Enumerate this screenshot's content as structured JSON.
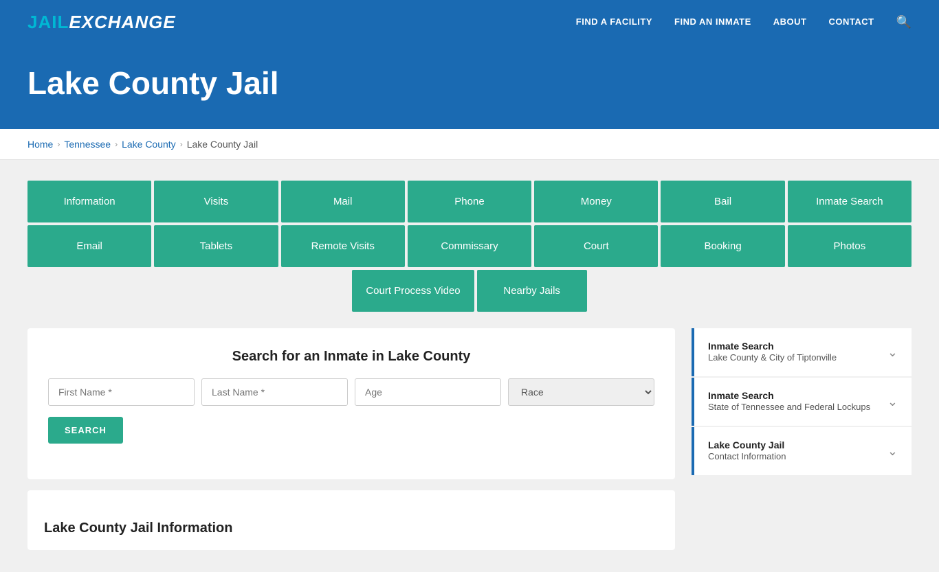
{
  "nav": {
    "logo_jail": "JAIL",
    "logo_exchange": "EXCHANGE",
    "links": [
      {
        "label": "FIND A FACILITY",
        "href": "#"
      },
      {
        "label": "FIND AN INMATE",
        "href": "#"
      },
      {
        "label": "ABOUT",
        "href": "#"
      },
      {
        "label": "CONTACT",
        "href": "#"
      }
    ]
  },
  "hero": {
    "title": "Lake County Jail"
  },
  "breadcrumb": {
    "items": [
      {
        "label": "Home",
        "href": "#"
      },
      {
        "label": "Tennessee",
        "href": "#"
      },
      {
        "label": "Lake County",
        "href": "#"
      },
      {
        "label": "Lake County Jail",
        "href": "#"
      }
    ]
  },
  "grid_row1": [
    {
      "label": "Information"
    },
    {
      "label": "Visits"
    },
    {
      "label": "Mail"
    },
    {
      "label": "Phone"
    },
    {
      "label": "Money"
    },
    {
      "label": "Bail"
    },
    {
      "label": "Inmate Search"
    }
  ],
  "grid_row2": [
    {
      "label": "Email"
    },
    {
      "label": "Tablets"
    },
    {
      "label": "Remote Visits"
    },
    {
      "label": "Commissary"
    },
    {
      "label": "Court"
    },
    {
      "label": "Booking"
    },
    {
      "label": "Photos"
    }
  ],
  "grid_row3": [
    {
      "label": "Court Process Video"
    },
    {
      "label": "Nearby Jails"
    }
  ],
  "search": {
    "title": "Search for an Inmate in Lake County",
    "first_name_placeholder": "First Name *",
    "last_name_placeholder": "Last Name *",
    "age_placeholder": "Age",
    "race_placeholder": "Race",
    "button_label": "SEARCH"
  },
  "info_heading": "Lake County Jail Information",
  "sidebar": {
    "items": [
      {
        "title": "Inmate Search",
        "subtitle": "Lake County & City of Tiptonville"
      },
      {
        "title": "Inmate Search",
        "subtitle": "State of Tennessee and Federal Lockups"
      },
      {
        "title": "Lake County Jail",
        "subtitle": "Contact Information"
      }
    ]
  }
}
